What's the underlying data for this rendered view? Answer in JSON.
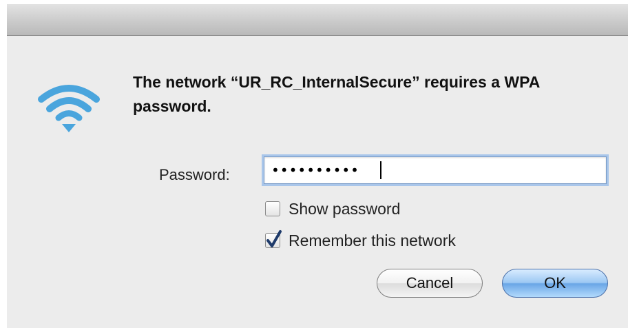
{
  "dialog": {
    "message": "The network “UR_RC_InternalSecure” requires a WPA password.",
    "icon": "wifi-icon"
  },
  "password": {
    "label": "Password:",
    "masked_value": "••••••••••"
  },
  "options": {
    "show_password": {
      "label": "Show password",
      "checked": false
    },
    "remember_network": {
      "label": "Remember this network",
      "checked": true
    }
  },
  "buttons": {
    "cancel_label": "Cancel",
    "ok_label": "OK"
  },
  "colors": {
    "wifi_accent": "#4aa5dd",
    "focus_ring": "#a9c6ea",
    "default_button": "#6aa6e6",
    "checkmark": "#1f3b6b"
  }
}
